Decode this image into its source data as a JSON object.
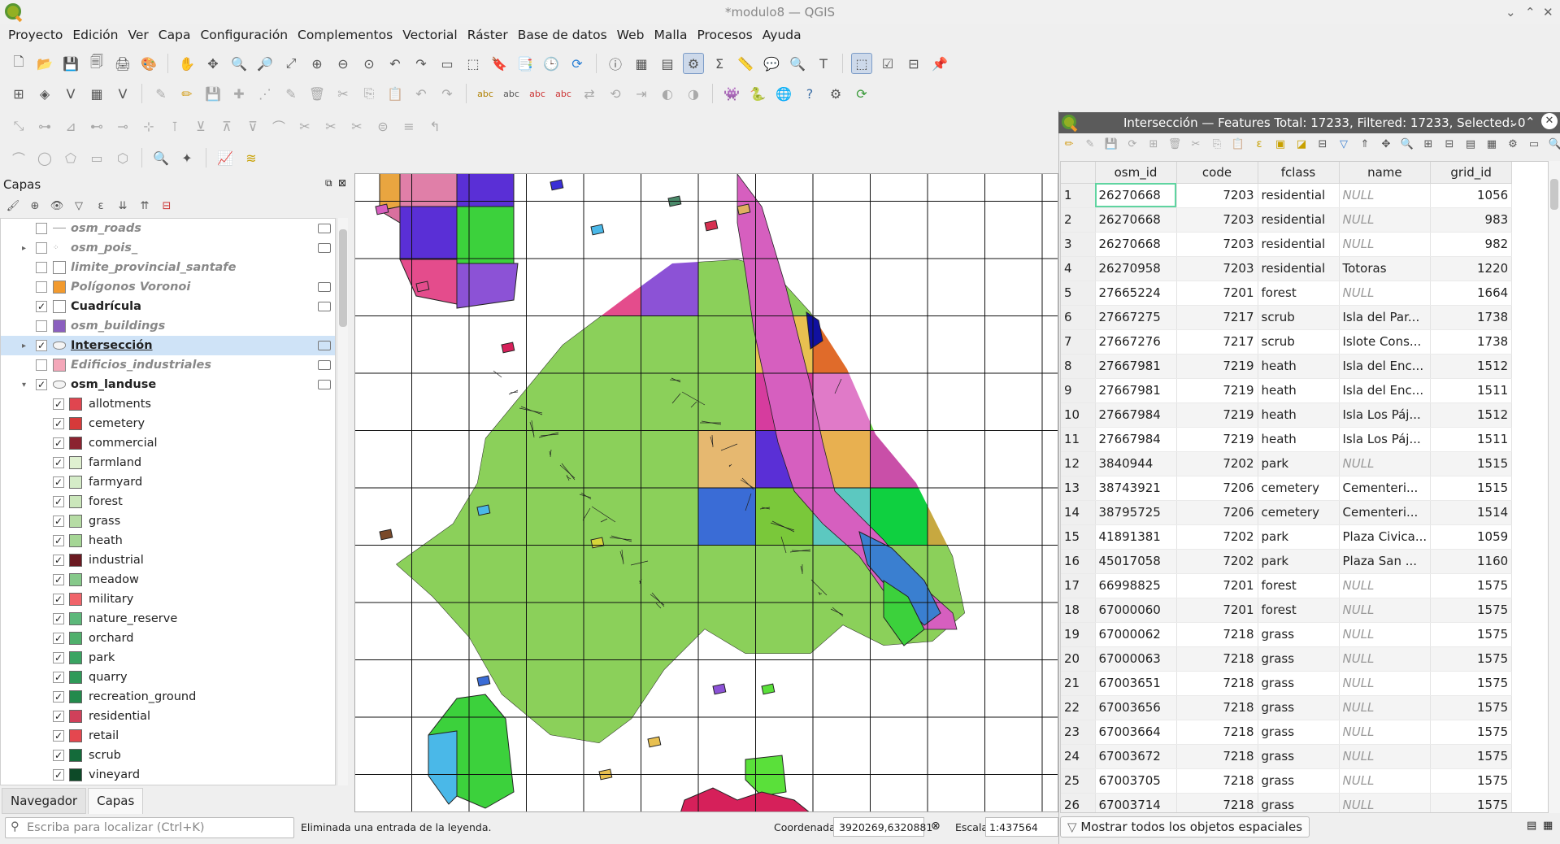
{
  "window": {
    "title": "*modulo8 — QGIS"
  },
  "menu": [
    "Proyecto",
    "Edición",
    "Ver",
    "Capa",
    "Configuración",
    "Complementos",
    "Vectorial",
    "Ráster",
    "Base de datos",
    "Web",
    "Malla",
    "Procesos",
    "Ayuda"
  ],
  "layers_panel": {
    "title": "Capas",
    "layers": [
      {
        "label": "osm_roads",
        "checked": false,
        "style": "it",
        "swatch": "line"
      },
      {
        "label": "osm_pois_",
        "checked": false,
        "style": "it",
        "swatch": "points",
        "expand": true
      },
      {
        "label": "limite_provincial_santafe",
        "checked": false,
        "style": "it",
        "swatch": "#ffffff"
      },
      {
        "label": "Polígonos Voronoi",
        "checked": false,
        "style": "it",
        "swatch": "#f29a2e"
      },
      {
        "label": "Cuadrícula",
        "checked": true,
        "style": "bd",
        "swatch": "#ffffff"
      },
      {
        "label": "osm_buildings",
        "checked": false,
        "style": "it",
        "swatch": "#8b5fbf"
      },
      {
        "label": "Intersección",
        "checked": true,
        "style": "bd",
        "swatch": "poly",
        "expand": true,
        "selected": true
      },
      {
        "label": "Edificios_industriales",
        "checked": false,
        "style": "it",
        "swatch": "#f4a7b9"
      },
      {
        "label": "osm_landuse",
        "checked": true,
        "style": "bd",
        "swatch": "poly",
        "expanded": true
      }
    ],
    "classes": [
      {
        "label": "allotments",
        "color": "#e0454f"
      },
      {
        "label": "cemetery",
        "color": "#d63a3a"
      },
      {
        "label": "commercial",
        "color": "#8b2330"
      },
      {
        "label": "farmland",
        "color": "#dff0d0"
      },
      {
        "label": "farmyard",
        "color": "#d5ecc8"
      },
      {
        "label": "forest",
        "color": "#cbe7bb"
      },
      {
        "label": "grass",
        "color": "#b6dca4"
      },
      {
        "label": "heath",
        "color": "#a5d695"
      },
      {
        "label": "industrial",
        "color": "#6b1a22"
      },
      {
        "label": "meadow",
        "color": "#86c98a"
      },
      {
        "label": "military",
        "color": "#f0646a"
      },
      {
        "label": "nature_reserve",
        "color": "#5cb87a"
      },
      {
        "label": "orchard",
        "color": "#4fb06c"
      },
      {
        "label": "park",
        "color": "#3aa462"
      },
      {
        "label": "quarry",
        "color": "#2e9a58"
      },
      {
        "label": "recreation_ground",
        "color": "#238a4c"
      },
      {
        "label": "residential",
        "color": "#d0405a"
      },
      {
        "label": "retail",
        "color": "#e4474f"
      },
      {
        "label": "scrub",
        "color": "#146b3a"
      },
      {
        "label": "vineyard",
        "color": "#0d4a28"
      }
    ],
    "tabs": [
      "Navegador",
      "Capas"
    ]
  },
  "attribute_table": {
    "title": "Intersección — Features Total: 17233, Filtered: 17233, Selected: 0",
    "columns": [
      "osm_id",
      "code",
      "fclass",
      "name",
      "grid_id"
    ],
    "rows": [
      [
        "1",
        "26270668",
        "7203",
        "residential",
        "NULL",
        "1056"
      ],
      [
        "2",
        "26270668",
        "7203",
        "residential",
        "NULL",
        "983"
      ],
      [
        "3",
        "26270668",
        "7203",
        "residential",
        "NULL",
        "982"
      ],
      [
        "4",
        "26270958",
        "7203",
        "residential",
        "Totoras",
        "1220"
      ],
      [
        "5",
        "27665224",
        "7201",
        "forest",
        "NULL",
        "1664"
      ],
      [
        "6",
        "27667275",
        "7217",
        "scrub",
        "Isla del Par...",
        "1738"
      ],
      [
        "7",
        "27667276",
        "7217",
        "scrub",
        "Islote Cons...",
        "1738"
      ],
      [
        "8",
        "27667981",
        "7219",
        "heath",
        "Isla del Enc...",
        "1512"
      ],
      [
        "9",
        "27667981",
        "7219",
        "heath",
        "Isla del Enc...",
        "1511"
      ],
      [
        "10",
        "27667984",
        "7219",
        "heath",
        "Isla Los Páj...",
        "1512"
      ],
      [
        "11",
        "27667984",
        "7219",
        "heath",
        "Isla Los Páj...",
        "1511"
      ],
      [
        "12",
        "3840944",
        "7202",
        "park",
        "NULL",
        "1515"
      ],
      [
        "13",
        "38743921",
        "7206",
        "cemetery",
        "Cementeri...",
        "1515"
      ],
      [
        "14",
        "38795725",
        "7206",
        "cemetery",
        "Cementeri...",
        "1514"
      ],
      [
        "15",
        "41891381",
        "7202",
        "park",
        "Plaza Civica...",
        "1059"
      ],
      [
        "16",
        "45017058",
        "7202",
        "park",
        "Plaza San ...",
        "1160"
      ],
      [
        "17",
        "66998825",
        "7201",
        "forest",
        "NULL",
        "1575"
      ],
      [
        "18",
        "67000060",
        "7201",
        "forest",
        "NULL",
        "1575"
      ],
      [
        "19",
        "67000062",
        "7218",
        "grass",
        "NULL",
        "1575"
      ],
      [
        "20",
        "67000063",
        "7218",
        "grass",
        "NULL",
        "1575"
      ],
      [
        "21",
        "67003651",
        "7218",
        "grass",
        "NULL",
        "1575"
      ],
      [
        "22",
        "67003656",
        "7218",
        "grass",
        "NULL",
        "1575"
      ],
      [
        "23",
        "67003664",
        "7218",
        "grass",
        "NULL",
        "1575"
      ],
      [
        "24",
        "67003672",
        "7218",
        "grass",
        "NULL",
        "1575"
      ],
      [
        "25",
        "67003705",
        "7218",
        "grass",
        "NULL",
        "1575"
      ],
      [
        "26",
        "67003714",
        "7218",
        "grass",
        "NULL",
        "1575"
      ]
    ],
    "show_all": "Mostrar todos los objetos espaciales"
  },
  "status": {
    "locator_placeholder": "Escriba para localizar (Ctrl+K)",
    "message": "Eliminada una entrada de la leyenda.",
    "coord_label": "Coordenada",
    "coord_value": "3920269,6320881",
    "scale_label": "Escala",
    "scale_value": "1:437564"
  },
  "map_colors": [
    "#5a2fd6",
    "#3cd13c",
    "#e44c8c",
    "#8c52d6",
    "#3a7fd0",
    "#8dc83c",
    "#e9a540",
    "#d9709e",
    "#e06b2a",
    "#2ee08a",
    "#7ea8e0",
    "#d65fbf",
    "#d63c9e",
    "#e07ac8",
    "#70d64c",
    "#e0482a",
    "#9ad87a",
    "#cfcf3a",
    "#e6b870",
    "#5a2fd6",
    "#e8c050",
    "#c94fa8",
    "#e0b060",
    "#c7a840",
    "#c4c43a",
    "#3a6cd6",
    "#5cc8c0",
    "#0fd040",
    "#d0b840",
    "#7ac83a",
    "#4a94e8",
    "#d8c050"
  ]
}
